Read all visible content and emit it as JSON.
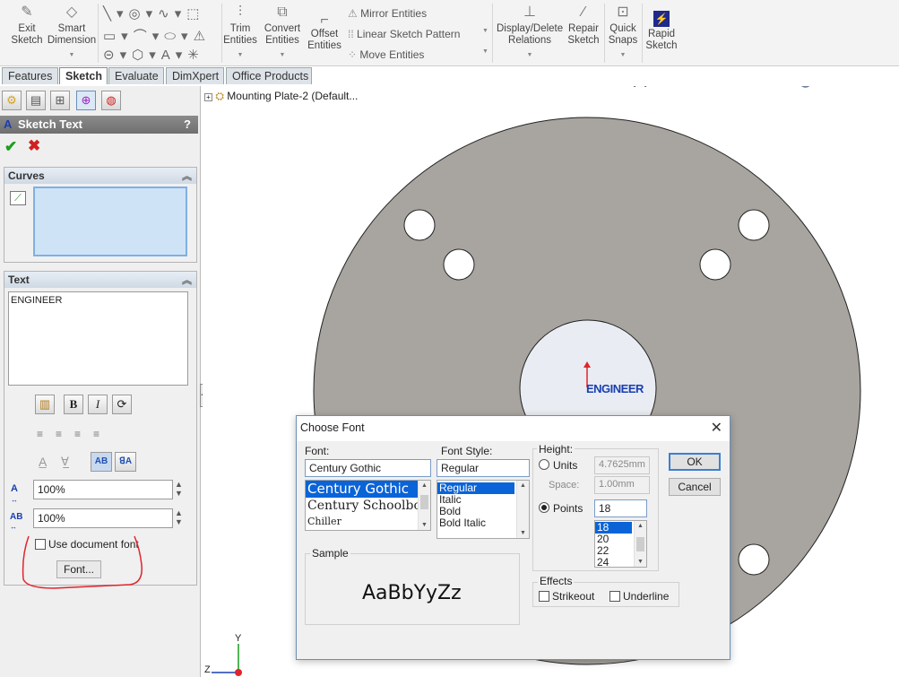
{
  "ribbon": {
    "exit_sketch": [
      "Exit",
      "Sketch"
    ],
    "smart_dimension": [
      "Smart",
      "Dimension"
    ],
    "trim_entities": [
      "Trim",
      "Entities"
    ],
    "convert_entities": [
      "Convert",
      "Entities"
    ],
    "offset_entities": [
      "Offset",
      "Entities"
    ],
    "mirror_entities": "Mirror Entities",
    "linear_sketch_pattern": "Linear Sketch Pattern",
    "move_entities": "Move Entities",
    "display_delete_relations": [
      "Display/Delete",
      "Relations"
    ],
    "repair_sketch": [
      "Repair",
      "Sketch"
    ],
    "quick_snaps": [
      "Quick",
      "Snaps"
    ],
    "rapid_sketch": [
      "Rapid",
      "Sketch"
    ]
  },
  "tabs": [
    "Features",
    "Sketch",
    "Evaluate",
    "DimXpert",
    "Office Products"
  ],
  "active_tab": "Sketch",
  "tree": {
    "part_name": "Mounting Plate-2  (Default..."
  },
  "property_manager": {
    "title": "Sketch Text",
    "help": "?",
    "curves_label": "Curves",
    "text_label": "Text",
    "text_value": "ENGINEER",
    "width_factor": "100%",
    "spacing": "100%",
    "use_document_font": "Use document font",
    "font_button": "Font..."
  },
  "graphics": {
    "sketch_text": "ENGINEER",
    "axis_y": "Y",
    "axis_z": "Z"
  },
  "dialog": {
    "title": "Choose Font",
    "font_label": "Font:",
    "font_value": "Century Gothic",
    "font_list": [
      "Century Gothic",
      "Century Schoolbook",
      "Chiller"
    ],
    "style_label": "Font Style:",
    "style_value": "Regular",
    "style_list": [
      "Regular",
      "Italic",
      "Bold",
      "Bold Italic"
    ],
    "height_label": "Height:",
    "units_label": "Units",
    "units_value": "4.7625mm",
    "space_label": "Space:",
    "space_value": "1.00mm",
    "points_label": "Points",
    "points_value": "18",
    "points_list": [
      "18",
      "20",
      "22",
      "24"
    ],
    "sample_label": "Sample",
    "sample_text": "AaBbYyZz",
    "effects_label": "Effects",
    "strikeout": "Strikeout",
    "underline": "Underline",
    "ok": "OK",
    "cancel": "Cancel"
  },
  "colors": {
    "part": "#a8a49f",
    "accent": "#0a64d8",
    "annotation": "#e0242c"
  }
}
